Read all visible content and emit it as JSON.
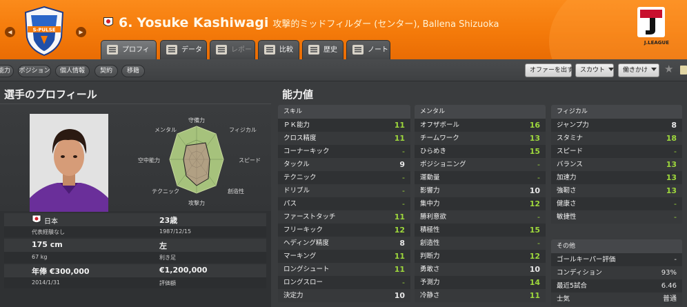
{
  "header": {
    "number": "6.",
    "name": "Yosuke Kashiwagi",
    "subtitle": "攻撃的ミッドフィルダー (センター), Ballena Shizuoka",
    "crest_text": "S-PULSE",
    "league_logo_text": "J.LEAGUE",
    "accent_color": "#f47a0a"
  },
  "tabs": [
    {
      "label": "プロフィール",
      "icon": "profile-icon",
      "state": "active"
    },
    {
      "label": "データ",
      "icon": "chart-icon",
      "state": "normal"
    },
    {
      "label": "レポート",
      "icon": "report-icon",
      "state": "disabled"
    },
    {
      "label": "比較",
      "icon": "compare-icon",
      "state": "normal"
    },
    {
      "label": "歴史",
      "icon": "history-icon",
      "state": "normal"
    },
    {
      "label": "ノート",
      "icon": "note-icon",
      "state": "normal"
    }
  ],
  "subnav": [
    "能力",
    "ポジション",
    "個人情報",
    "契約",
    "移籍"
  ],
  "actions": {
    "offer": "オファーを出す",
    "scout": "スカウト",
    "approach": "働きかけ"
  },
  "sections": {
    "profile": "選手のプロフィール",
    "attributes": "能力値"
  },
  "radar_labels": {
    "top": "守備力",
    "top_right": "フィジカル",
    "right": "スピード",
    "bottom_right": "創造性",
    "bottom": "攻撃力",
    "bottom_left": "テクニック",
    "left": "空中能力",
    "top_left": "メンタル"
  },
  "profile_info": {
    "nationality": "日本",
    "international": "代表経験なし",
    "age": "23歳",
    "birth": "1987/12/15",
    "height": "175 cm",
    "weight": "67 kg",
    "foot": "左",
    "foot_label": "利き足",
    "wage": "年俸 €300,000",
    "contract_end": "2014/1/31",
    "value": "€1,200,000",
    "value_label": "評価額"
  },
  "skills": {
    "title": "スキル",
    "rows": [
      {
        "label": "ＰＫ能力",
        "value": "11"
      },
      {
        "label": "クロス精度",
        "value": "11"
      },
      {
        "label": "コーナーキック",
        "value": "-"
      },
      {
        "label": "タックル",
        "value": "9"
      },
      {
        "label": "テクニック",
        "value": "-"
      },
      {
        "label": "ドリブル",
        "value": "-"
      },
      {
        "label": "パス",
        "value": "-"
      },
      {
        "label": "ファーストタッチ",
        "value": "11"
      },
      {
        "label": "フリーキック",
        "value": "12"
      },
      {
        "label": "ヘディング精度",
        "value": "8"
      },
      {
        "label": "マーキング",
        "value": "11"
      },
      {
        "label": "ロングシュート",
        "value": "11"
      },
      {
        "label": "ロングスロー",
        "value": "-"
      },
      {
        "label": "決定力",
        "value": "10"
      }
    ]
  },
  "mental": {
    "title": "メンタル",
    "rows": [
      {
        "label": "オフザボール",
        "value": "16"
      },
      {
        "label": "チームワーク",
        "value": "13"
      },
      {
        "label": "ひらめき",
        "value": "15"
      },
      {
        "label": "ポジショニング",
        "value": "-"
      },
      {
        "label": "運動量",
        "value": "-"
      },
      {
        "label": "影響力",
        "value": "10"
      },
      {
        "label": "集中力",
        "value": "12"
      },
      {
        "label": "勝利意欲",
        "value": "-"
      },
      {
        "label": "積極性",
        "value": "15"
      },
      {
        "label": "創造性",
        "value": "-"
      },
      {
        "label": "判断力",
        "value": "12"
      },
      {
        "label": "勇敢さ",
        "value": "10"
      },
      {
        "label": "予測力",
        "value": "14"
      },
      {
        "label": "冷静さ",
        "value": "11"
      }
    ]
  },
  "physical": {
    "title": "フィジカル",
    "rows": [
      {
        "label": "ジャンプ力",
        "value": "8"
      },
      {
        "label": "スタミナ",
        "value": "18"
      },
      {
        "label": "スピード",
        "value": "-"
      },
      {
        "label": "バランス",
        "value": "13"
      },
      {
        "label": "加速力",
        "value": "13"
      },
      {
        "label": "強靭さ",
        "value": "13"
      },
      {
        "label": "健康さ",
        "value": "-"
      },
      {
        "label": "敏捷性",
        "value": "-"
      }
    ]
  },
  "other": {
    "title": "その他",
    "rows": [
      {
        "label": "ゴールキーパー評価",
        "value": "-"
      },
      {
        "label": "コンディション",
        "value": "93%"
      },
      {
        "label": "最近5試合",
        "value": "6.46"
      },
      {
        "label": "士気",
        "value": "普通"
      }
    ]
  }
}
